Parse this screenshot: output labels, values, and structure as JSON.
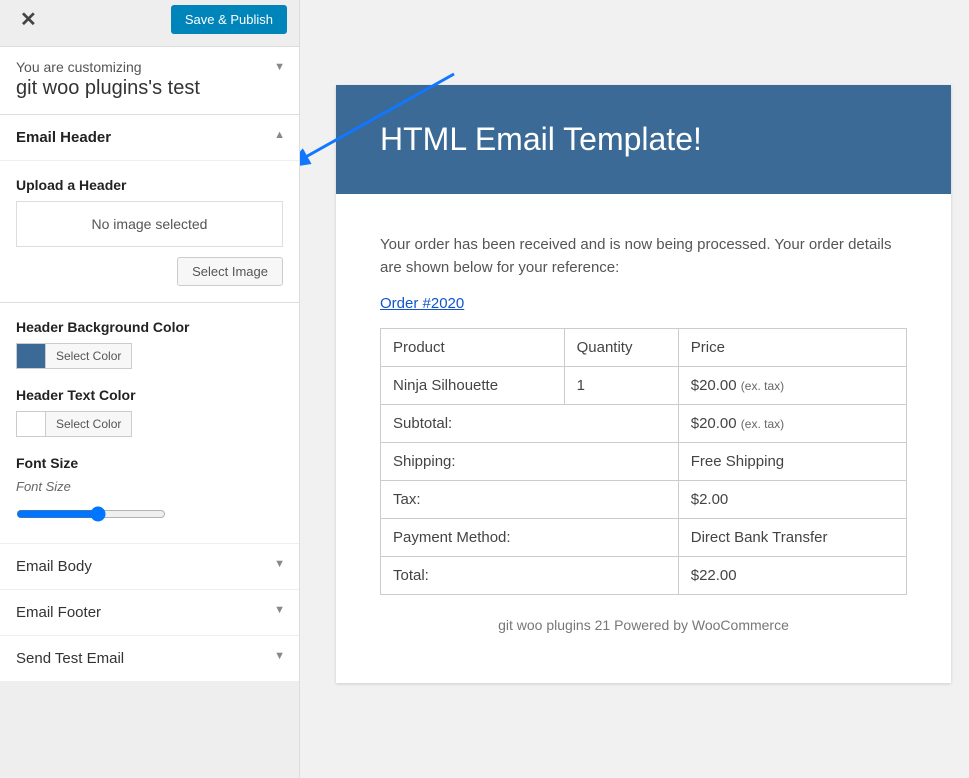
{
  "topbar": {
    "close": "✕",
    "save_label": "Save & Publish"
  },
  "customizing": {
    "intro": "You are customizing",
    "site_title": "git woo plugins's test"
  },
  "panel": {
    "title": "Email Header",
    "upload_label": "Upload a Header",
    "upload_placeholder": "No image selected",
    "select_image": "Select Image",
    "bg_color_label": "Header Background Color",
    "select_color": "Select Color",
    "text_color_label": "Header Text Color",
    "font_size_label": "Font Size",
    "font_size_sub": "Font Size",
    "bg_color": "#3a6a95",
    "text_color": "#ffffff"
  },
  "accordions": [
    {
      "label": "Email Body"
    },
    {
      "label": "Email Footer"
    },
    {
      "label": "Send Test Email"
    }
  ],
  "preview": {
    "header_title": "HTML Email Template!",
    "body_text": "Your order has been received and is now being processed. Your order details are shown below for your reference:",
    "order_link": "Order #2020",
    "columns": {
      "product": "Product",
      "quantity": "Quantity",
      "price": "Price"
    },
    "items": [
      {
        "product": "Ninja Silhouette",
        "quantity": "1",
        "price": "$20.00",
        "tax_note": "(ex. tax)"
      }
    ],
    "summary": [
      {
        "label": "Subtotal:",
        "value": "$20.00",
        "tax_note": "(ex. tax)"
      },
      {
        "label": "Shipping:",
        "value": "Free Shipping"
      },
      {
        "label": "Tax:",
        "value": "$2.00"
      },
      {
        "label": "Payment Method:",
        "value": "Direct Bank Transfer"
      },
      {
        "label": "Total:",
        "value": "$22.00"
      }
    ],
    "footer": "git woo plugins 21 Powered by WooCommerce"
  }
}
